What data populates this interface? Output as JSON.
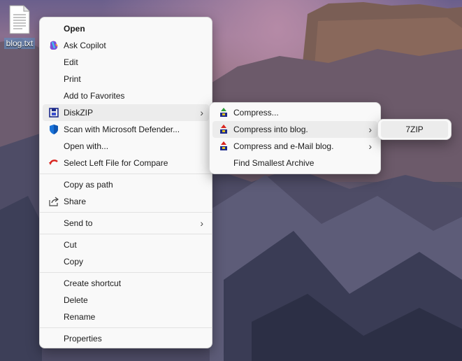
{
  "desktop": {
    "file_label": "blog.txt"
  },
  "context_menu": {
    "open": "Open",
    "ask_copilot": "Ask Copilot",
    "edit": "Edit",
    "print": "Print",
    "add_to_favorites": "Add to Favorites",
    "diskzip": "DiskZIP",
    "scan_defender": "Scan with Microsoft Defender...",
    "open_with": "Open with...",
    "select_left_compare": "Select Left File for Compare",
    "copy_as_path": "Copy as path",
    "share": "Share",
    "send_to": "Send to",
    "cut": "Cut",
    "copy": "Copy",
    "create_shortcut": "Create shortcut",
    "delete": "Delete",
    "rename": "Rename",
    "properties": "Properties"
  },
  "diskzip_submenu": {
    "compress": "Compress...",
    "compress_into": "Compress into blog.",
    "compress_email": "Compress and e-Mail blog.",
    "find_smallest": "Find Smallest Archive"
  },
  "compress_into_submenu": {
    "format_7zip": "7ZIP"
  },
  "colors": {
    "menu_bg": "#f9f9f9",
    "hover_bg": "#ececec",
    "defender_blue": "#1a73d9",
    "copilot_purple": "#7b4fd6"
  }
}
